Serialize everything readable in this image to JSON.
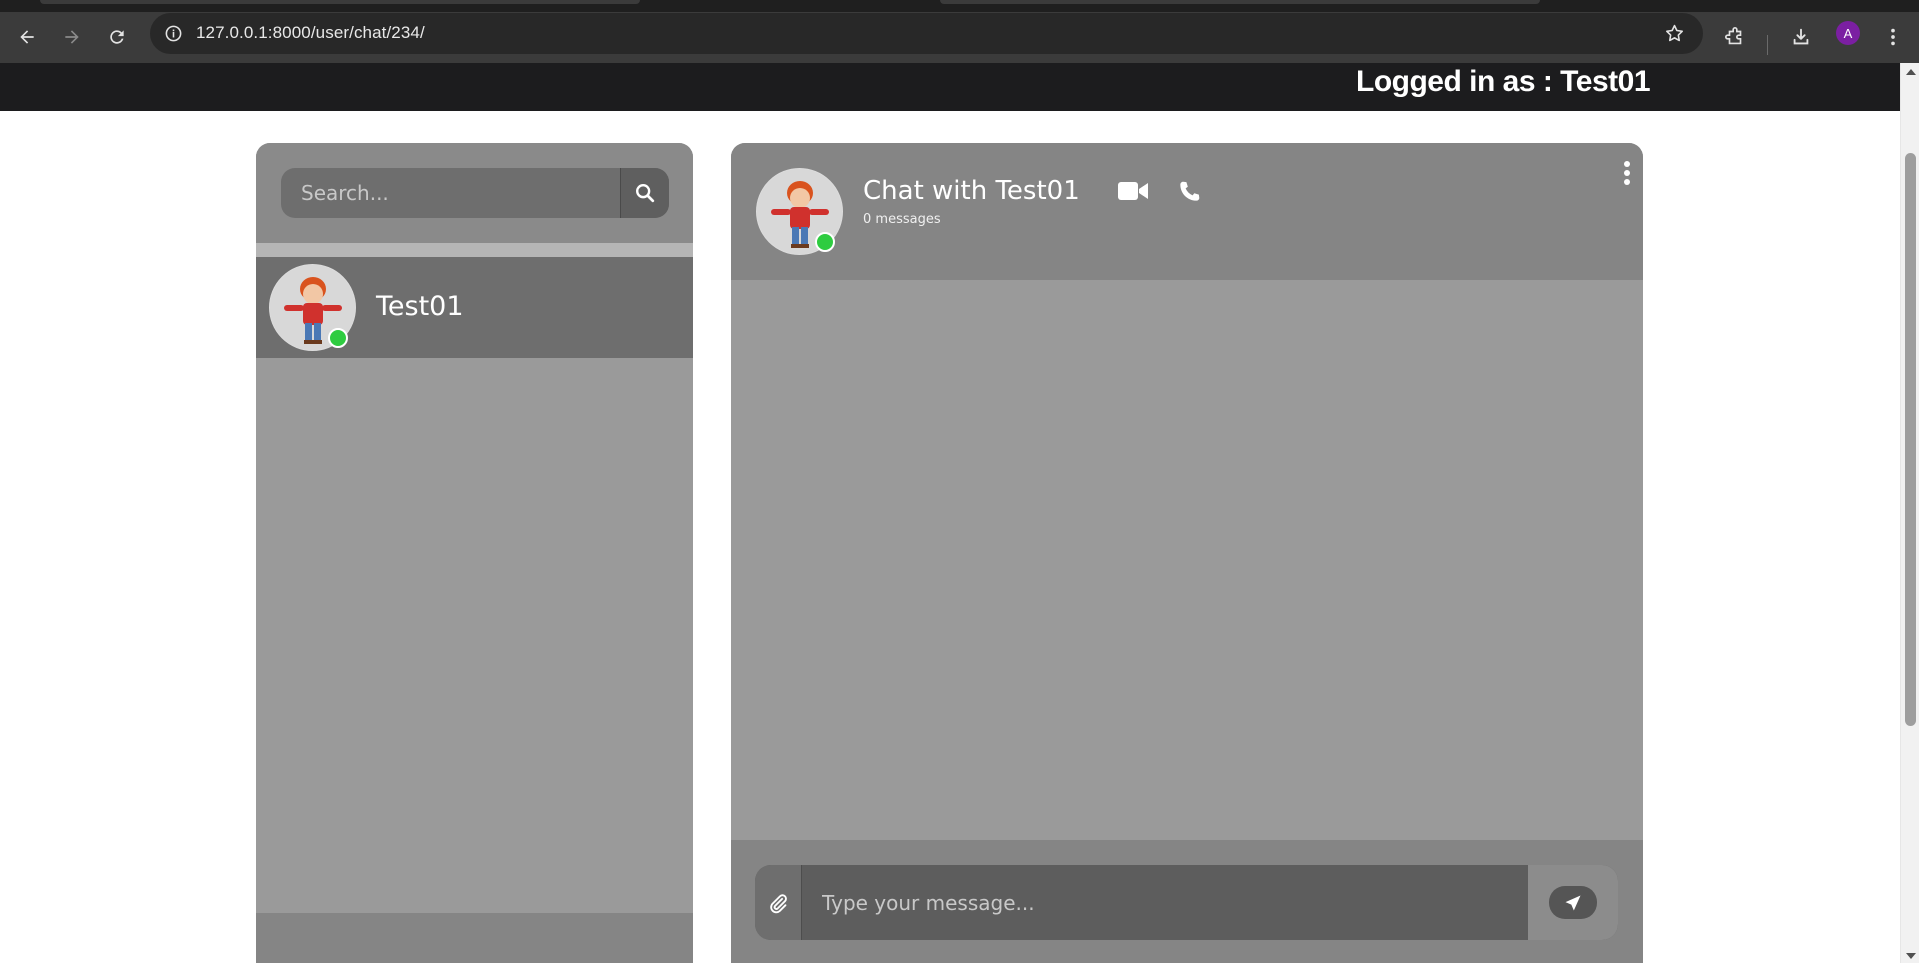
{
  "browser": {
    "url": "127.0.0.1:8000/user/chat/234/",
    "profile_initial": "A",
    "profile_color": "#7b1fa2"
  },
  "header": {
    "logged_in_text": "Logged in as : Test01"
  },
  "sidebar": {
    "search_placeholder": "Search...",
    "contacts": [
      {
        "name": "Test01",
        "online": true
      }
    ]
  },
  "chat": {
    "title": "Chat with Test01",
    "message_count": "0 messages",
    "composer_placeholder": "Type your message..."
  },
  "colors": {
    "online": "#2ecc40",
    "header_bg": "#1c1c1e",
    "panel_bg": "#9a9a9a"
  },
  "icons": {
    "header": [
      "video-camera-icon",
      "phone-icon",
      "more-vertical-icon"
    ],
    "composer": [
      "paperclip-icon",
      "send-icon"
    ],
    "search": "search-icon"
  }
}
